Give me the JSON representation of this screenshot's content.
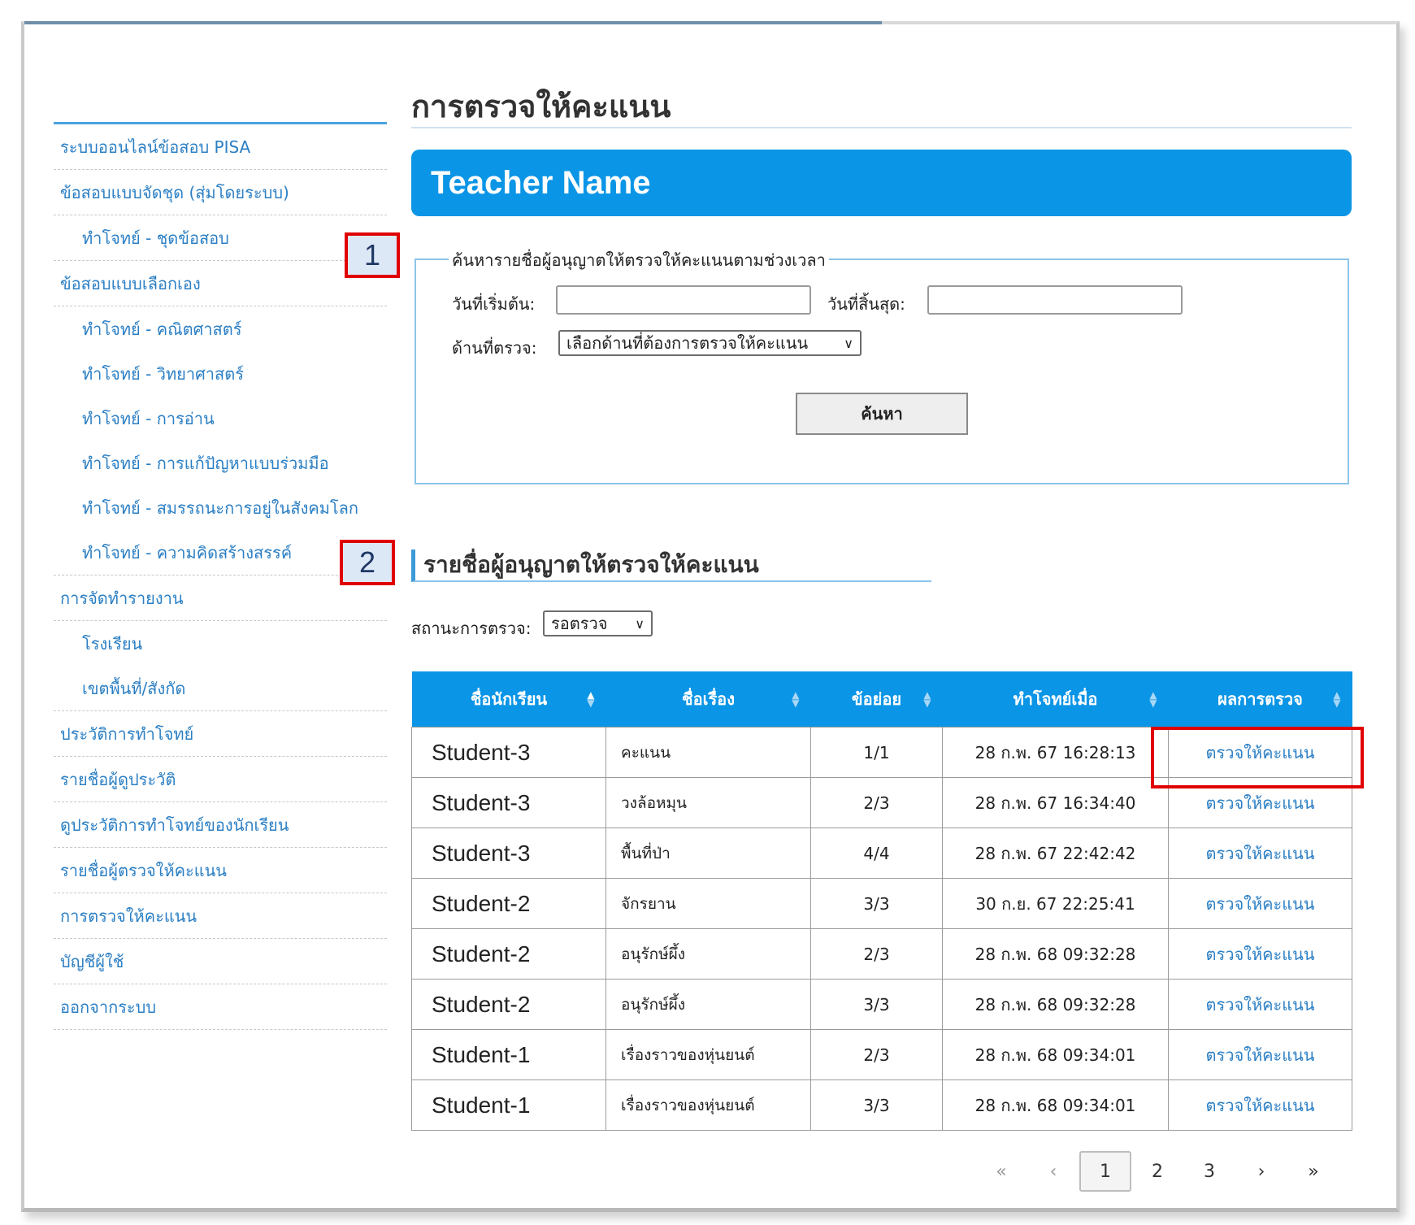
{
  "page": {
    "title": "การตรวจให้คะแนน"
  },
  "teacher": {
    "name": "Teacher Name"
  },
  "sidebar": {
    "items": [
      {
        "label": "ระบบออนไลน์ข้อสอบ PISA",
        "sub": false
      },
      {
        "label": "ข้อสอบแบบจัดชุด (สุ่มโดยระบบ)",
        "sub": false
      },
      {
        "label": "ทำโจทย์ - ชุดข้อสอบ",
        "sub": true,
        "last": true
      },
      {
        "label": "ข้อสอบแบบเลือกเอง",
        "sub": false
      },
      {
        "label": "ทำโจทย์ - คณิตศาสตร์",
        "sub": true
      },
      {
        "label": "ทำโจทย์ - วิทยาศาสตร์",
        "sub": true
      },
      {
        "label": "ทำโจทย์ - การอ่าน",
        "sub": true
      },
      {
        "label": "ทำโจทย์ - การแก้ปัญหาแบบร่วมมือ",
        "sub": true
      },
      {
        "label": "ทำโจทย์ - สมรรถนะการอยู่ในสังคมโลก",
        "sub": true
      },
      {
        "label": "ทำโจทย์ - ความคิดสร้างสรรค์",
        "sub": true,
        "last": true
      },
      {
        "label": "การจัดทำรายงาน",
        "sub": false
      },
      {
        "label": "โรงเรียน",
        "sub": true
      },
      {
        "label": "เขตพื้นที่/สังกัด",
        "sub": true,
        "last": true
      },
      {
        "label": "ประวัติการทำโจทย์",
        "sub": false
      },
      {
        "label": "รายชื่อผู้ดูประวัติ",
        "sub": false
      },
      {
        "label": "ดูประวัติการทำโจทย์ของนักเรียน",
        "sub": false
      },
      {
        "label": "รายชื่อผู้ตรวจให้คะแนน",
        "sub": false
      },
      {
        "label": "การตรวจให้คะแนน",
        "sub": false
      },
      {
        "label": "บัญชีผู้ใช้",
        "sub": false
      },
      {
        "label": "ออกจากระบบ",
        "sub": false
      }
    ]
  },
  "annotations": {
    "one": "1",
    "two": "2"
  },
  "search": {
    "legend": "ค้นหารายชื่อผู้อนุญาตให้ตรวจให้คะแนนตามช่วงเวลา",
    "start_label": "วันที่เริ่มต้น:",
    "start_value": "",
    "end_label": "วันที่สิ้นสุด:",
    "end_value": "",
    "aspect_label": "ด้านที่ตรวจ:",
    "aspect_selected": "เลือกด้านที่ต้องการตรวจให้คะแนน",
    "button": "ค้นหา"
  },
  "list": {
    "title": "รายชื่อผู้อนุญาตให้ตรวจให้คะแนน",
    "status_label": "สถานะการตรวจ:",
    "status_selected": "รอตรวจ"
  },
  "table": {
    "headers": [
      "ชื่อนักเรียน",
      "ชื่อเรื่อง",
      "ข้อย่อย",
      "ทำโจทย์เมื่อ",
      "ผลการตรวจ"
    ],
    "rows": [
      {
        "student": "Student-3",
        "story": "คะแนน",
        "item": "1/1",
        "when": "28 ก.พ. 67 16:28:13",
        "action": "ตรวจให้คะแนน"
      },
      {
        "student": "Student-3",
        "story": "วงล้อหมุน",
        "item": "2/3",
        "when": "28 ก.พ. 67 16:34:40",
        "action": "ตรวจให้คะแนน"
      },
      {
        "student": "Student-3",
        "story": "พื้นที่ป่า",
        "item": "4/4",
        "when": "28 ก.พ. 67 22:42:42",
        "action": "ตรวจให้คะแนน"
      },
      {
        "student": "Student-2",
        "story": "จักรยาน",
        "item": "3/3",
        "when": "30 ก.ย. 67 22:25:41",
        "action": "ตรวจให้คะแนน"
      },
      {
        "student": "Student-2",
        "story": "อนุรักษ์ผึ้ง",
        "item": "2/3",
        "when": "28 ก.พ. 68 09:32:28",
        "action": "ตรวจให้คะแนน"
      },
      {
        "student": "Student-2",
        "story": "อนุรักษ์ผึ้ง",
        "item": "3/3",
        "when": "28 ก.พ. 68 09:32:28",
        "action": "ตรวจให้คะแนน"
      },
      {
        "student": "Student-1",
        "story": "เรื่องราวของหุ่นยนต์",
        "item": "2/3",
        "when": "28 ก.พ. 68 09:34:01",
        "action": "ตรวจให้คะแนน"
      },
      {
        "student": "Student-1",
        "story": "เรื่องราวของหุ่นยนต์",
        "item": "3/3",
        "when": "28 ก.พ. 68 09:34:01",
        "action": "ตรวจให้คะแนน"
      }
    ]
  },
  "pagination": {
    "first": "«",
    "prev": "‹",
    "pages": [
      "1",
      "2",
      "3"
    ],
    "current": "1",
    "next": "›",
    "last": "»"
  },
  "colors": {
    "accent": "#0b95e6",
    "link": "#2b7fc4",
    "highlight": "#e00000"
  }
}
